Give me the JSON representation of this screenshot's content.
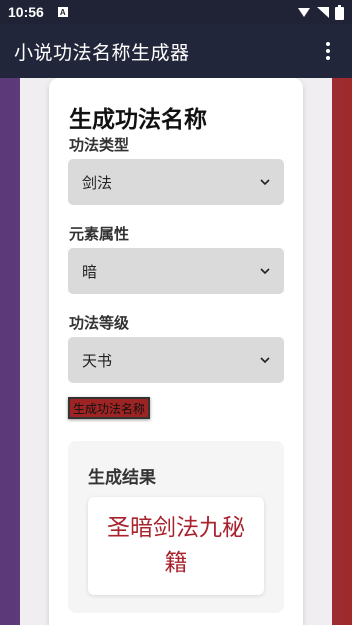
{
  "status_bar": {
    "time": "10:56",
    "a_icon": "A"
  },
  "app_bar": {
    "title": "小说功法名称生成器"
  },
  "form": {
    "heading": "生成功法名称",
    "fields": [
      {
        "label": "功法类型",
        "selected": "剑法"
      },
      {
        "label": "元素属性",
        "selected": "暗"
      },
      {
        "label": "功法等级",
        "selected": "天书"
      }
    ],
    "generate_label": "生成功法名称"
  },
  "result": {
    "heading": "生成结果",
    "name": "圣暗剑法九秘籍"
  },
  "colors": {
    "app_bar": "#22263a",
    "button": "#9e2424",
    "result_text": "#a8232e",
    "select_bg": "#dadada"
  }
}
